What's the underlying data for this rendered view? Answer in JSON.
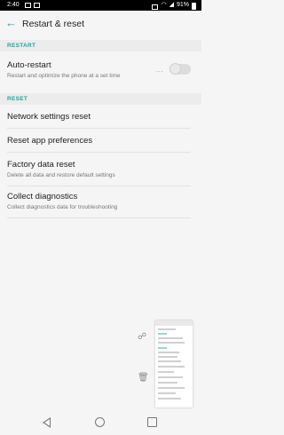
{
  "status_bar": {
    "time": "2:40",
    "battery": "91%"
  },
  "app_bar": {
    "title": "Restart & reset"
  },
  "sections": {
    "restart_header": "RESTART",
    "reset_header": "RESET"
  },
  "auto_restart": {
    "title": "Auto-restart",
    "subtitle": "Restart and optimize the phone at a set time",
    "more": "...",
    "toggle_on": false
  },
  "reset_items": [
    {
      "title": "Network settings reset"
    },
    {
      "title": "Reset app preferences"
    },
    {
      "title": "Factory data reset",
      "subtitle": "Delete all data and restore default settings"
    },
    {
      "title": "Collect diagnostics",
      "subtitle": "Collect diagnostics data for troubleshooting"
    }
  ],
  "icons": {
    "back": "arrow-left-icon",
    "share": "share-icon",
    "delete": "trash-icon",
    "nav_back": "nav-back-icon",
    "nav_home": "nav-home-icon",
    "nav_recent": "nav-recent-icon"
  },
  "colors": {
    "accent": "#27a39b",
    "background": "#f5f5f5"
  }
}
